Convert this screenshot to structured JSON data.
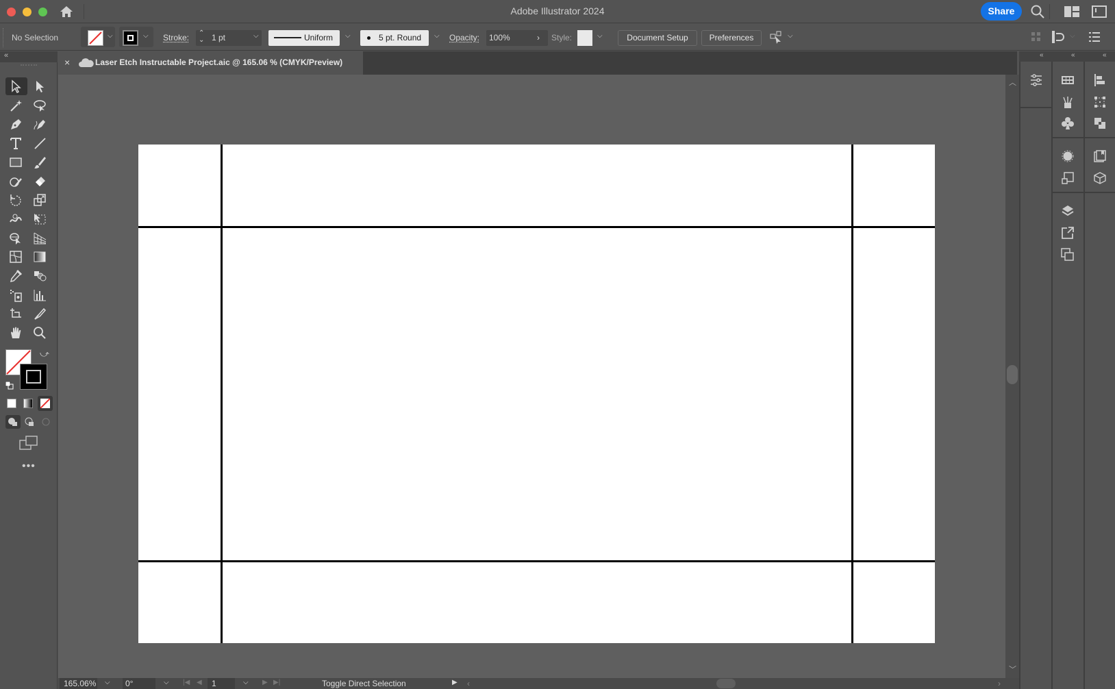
{
  "window": {
    "title": "Adobe Illustrator 2024",
    "share_label": "Share",
    "icons": [
      "home-icon",
      "search-icon",
      "workspace-switcher-icon",
      "panel-toggle-icon"
    ]
  },
  "control_bar": {
    "selection_label": "No Selection",
    "stroke_label": "Stroke:",
    "stroke_weight": "1 pt",
    "stroke_profile": "Uniform",
    "brush": "5 pt. Round",
    "opacity_label": "Opacity:",
    "opacity_value": "100%",
    "style_label": "Style:",
    "document_setup_label": "Document Setup",
    "preferences_label": "Preferences"
  },
  "document_tab": {
    "title": "Laser Etch Instructable Project.aic @ 165.06 % (CMYK/Preview)",
    "close": "×"
  },
  "tools": [
    "selection-tool",
    "direct-selection-tool",
    "magic-wand-tool",
    "lasso-tool",
    "pen-tool",
    "curvature-tool",
    "type-tool",
    "line-segment-tool",
    "rectangle-tool",
    "paintbrush-tool",
    "shaper-tool",
    "eraser-tool",
    "rotate-tool",
    "scale-tool",
    "warp-tool",
    "free-transform-tool",
    "shape-builder-tool",
    "perspective-grid-tool",
    "mesh-tool",
    "gradient-tool",
    "eyedropper-tool",
    "blend-tool",
    "symbol-sprayer-tool",
    "column-graph-tool",
    "artboard-tool",
    "slice-tool",
    "hand-tool",
    "zoom-tool"
  ],
  "fill_stroke": {
    "fill": "none",
    "stroke": "#000000",
    "none_color": "#e8312f"
  },
  "status_bar": {
    "zoom": "165.06%",
    "rotation": "0°",
    "artboard_number": "1",
    "status_text": "Toggle Direct Selection"
  },
  "right_panels": {
    "column1": [
      "properties-icon"
    ],
    "column2": [
      "swatches-icon",
      "brushes-icon",
      "symbols-icon",
      "appearance-icon",
      "graphic-styles-icon",
      "layers-icon",
      "export-icon",
      "artboards-icon"
    ],
    "column3": [
      "align-icon",
      "transform-icon",
      "pathfinder-icon",
      "libraries-icon",
      "3d-icon"
    ]
  },
  "colors": {
    "accent": "#1473e6",
    "canvas": "#5f5f5f",
    "chrome": "#535353"
  }
}
